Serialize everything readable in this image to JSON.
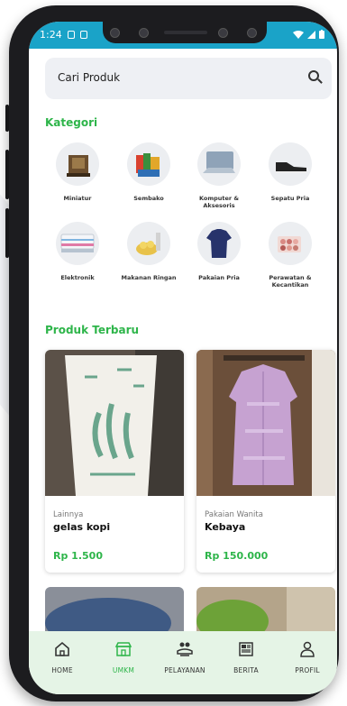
{
  "status_bar": {
    "time": "1:24"
  },
  "search": {
    "placeholder": "Cari Produk"
  },
  "categories_section": {
    "title": "Kategori"
  },
  "categories": [
    {
      "label": "Miniatur",
      "icon": "miniature-icon"
    },
    {
      "label": "Sembako",
      "icon": "groceries-icon"
    },
    {
      "label": "Komputer & Aksesoris",
      "icon": "laptop-icon"
    },
    {
      "label": "Sepatu Pria",
      "icon": "shoe-icon"
    },
    {
      "label": "Elektronik",
      "icon": "air-conditioner-icon"
    },
    {
      "label": "Makanan Ringan",
      "icon": "snack-icon"
    },
    {
      "label": "Pakaian Pria",
      "icon": "shirt-icon"
    },
    {
      "label": "Perawatan & Kecantikan",
      "icon": "makeup-icon"
    }
  ],
  "products_section": {
    "title": "Produk Terbaru"
  },
  "products": [
    {
      "category": "Lainnya",
      "name": "gelas kopi",
      "price": "Rp 1.500"
    },
    {
      "category": "Pakaian Wanita",
      "name": "Kebaya",
      "price": "Rp 150.000"
    }
  ],
  "bottom_nav": [
    {
      "label": "HOME",
      "icon": "home-icon"
    },
    {
      "label": "UMKM",
      "icon": "store-icon",
      "active": true
    },
    {
      "label": "PELAYANAN",
      "icon": "service-icon"
    },
    {
      "label": "BERITA",
      "icon": "news-icon"
    },
    {
      "label": "PROFIL",
      "icon": "profile-icon"
    }
  ],
  "colors": {
    "accent": "#2eb54a",
    "status_bar": "#1aa3c8",
    "nav_bg": "#e5f4e6"
  }
}
